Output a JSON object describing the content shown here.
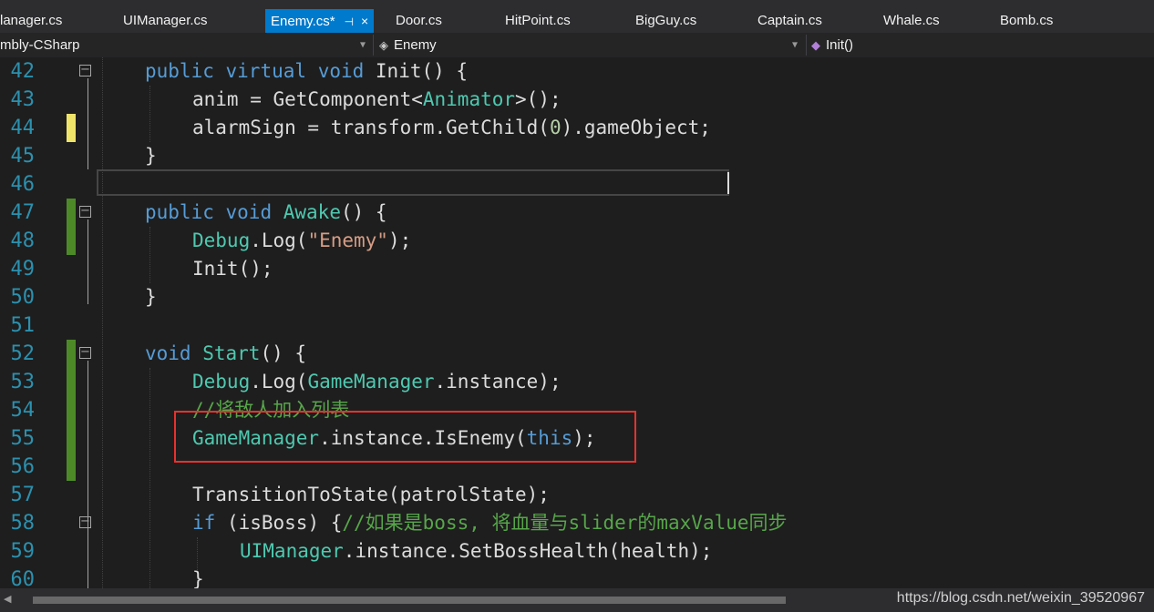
{
  "tabs": [
    {
      "label": "lanager.cs",
      "active": false
    },
    {
      "label": "UIManager.cs",
      "active": false
    },
    {
      "label": "Enemy.cs*",
      "active": true
    },
    {
      "label": "Door.cs",
      "active": false
    },
    {
      "label": "HitPoint.cs",
      "active": false
    },
    {
      "label": "BigGuy.cs",
      "active": false
    },
    {
      "label": "Captain.cs",
      "active": false
    },
    {
      "label": "Whale.cs",
      "active": false
    },
    {
      "label": "Bomb.cs",
      "active": false
    }
  ],
  "tab_icons": {
    "pin": "⊣",
    "close": "×"
  },
  "navbar": {
    "project": "mbly-CSharp",
    "class": "Enemy",
    "member": "Init()"
  },
  "lines": [
    {
      "n": "42"
    },
    {
      "n": "43"
    },
    {
      "n": "44"
    },
    {
      "n": "45"
    },
    {
      "n": "46"
    },
    {
      "n": "47"
    },
    {
      "n": "48"
    },
    {
      "n": "49"
    },
    {
      "n": "50"
    },
    {
      "n": "51"
    },
    {
      "n": "52"
    },
    {
      "n": "53"
    },
    {
      "n": "54"
    },
    {
      "n": "55"
    },
    {
      "n": "56"
    },
    {
      "n": "57"
    },
    {
      "n": "58"
    },
    {
      "n": "59"
    },
    {
      "n": "60"
    }
  ],
  "code": {
    "l42": {
      "k1": "public",
      "k2": "virtual",
      "k3": "void",
      "t": " Init() {"
    },
    "l43": {
      "a": "anim = GetComponent<",
      "ty": "Animator",
      "b": ">();"
    },
    "l44": {
      "a": "alarmSign = transform.GetChild(",
      "num": "0",
      "b": ").gameObject;"
    },
    "l45": {
      "a": "}"
    },
    "l47": {
      "k1": "public",
      "k2": "void",
      "ty": "Awake",
      "t": "() {"
    },
    "l48": {
      "ty": "Debug",
      "a": ".Log(",
      "s": "\"Enemy\"",
      "b": ");"
    },
    "l49": {
      "a": "Init();"
    },
    "l50": {
      "a": "}"
    },
    "l52": {
      "k1": "void",
      "ty": "Start",
      "t": "() {"
    },
    "l53": {
      "ty": "Debug",
      "a": ".Log(",
      "ty2": "GameManager",
      "b": ".instance);"
    },
    "l54": {
      "c": "//将敌人加入列表"
    },
    "l55": {
      "ty": "GameManager",
      "a": ".instance.IsEnemy(",
      "k": "this",
      "b": ");"
    },
    "l57": {
      "a": "TransitionToState(patrolState);"
    },
    "l58": {
      "k": "if",
      "a": " (isBoss) {",
      "c": "//如果是boss, 将血量与slider的maxValue同步"
    },
    "l59": {
      "ty": "UIManager",
      "a": ".instance.SetBossHealth(health);"
    },
    "l60": {
      "a": "}"
    }
  },
  "status": {
    "watermark": "https://blog.csdn.net/weixin_39520967"
  },
  "colors": {
    "keyword": "#569cd6",
    "type": "#4ec9b0",
    "string": "#d69d85",
    "comment": "#57a64a",
    "active_tab": "#007acc",
    "highlight_box": "#e8312f"
  }
}
